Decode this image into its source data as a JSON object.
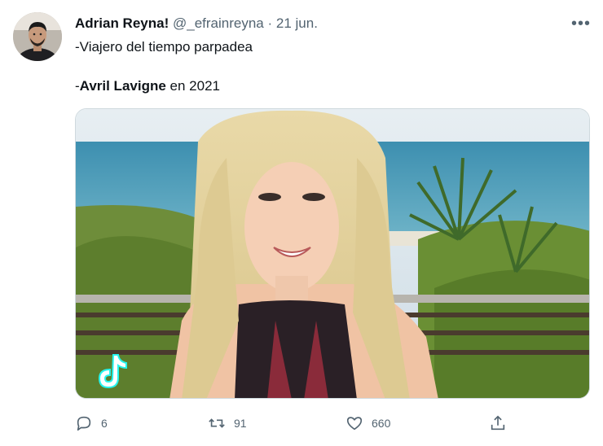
{
  "tweet": {
    "author": {
      "display_name": "Adrian Reyna!",
      "handle": "@_efrainreyna",
      "separator": "·",
      "date": "21 jun."
    },
    "more_label": "•••",
    "text": {
      "line1": "-Viajero del tiempo parpadea",
      "line2_prefix": "-",
      "line2_bold": "Avril Lavigne",
      "line2_suffix": " en 2021"
    },
    "media": {
      "type": "photo",
      "watermark_icon": "tiktok-logo-icon"
    },
    "actions": {
      "reply": {
        "icon": "reply-icon",
        "count": "6"
      },
      "retweet": {
        "icon": "retweet-icon",
        "count": "91"
      },
      "like": {
        "icon": "heart-icon",
        "count": "660"
      },
      "share": {
        "icon": "share-icon"
      }
    }
  },
  "colors": {
    "text_primary": "#0f1419",
    "text_secondary": "#536471",
    "border": "#cfd9de"
  }
}
